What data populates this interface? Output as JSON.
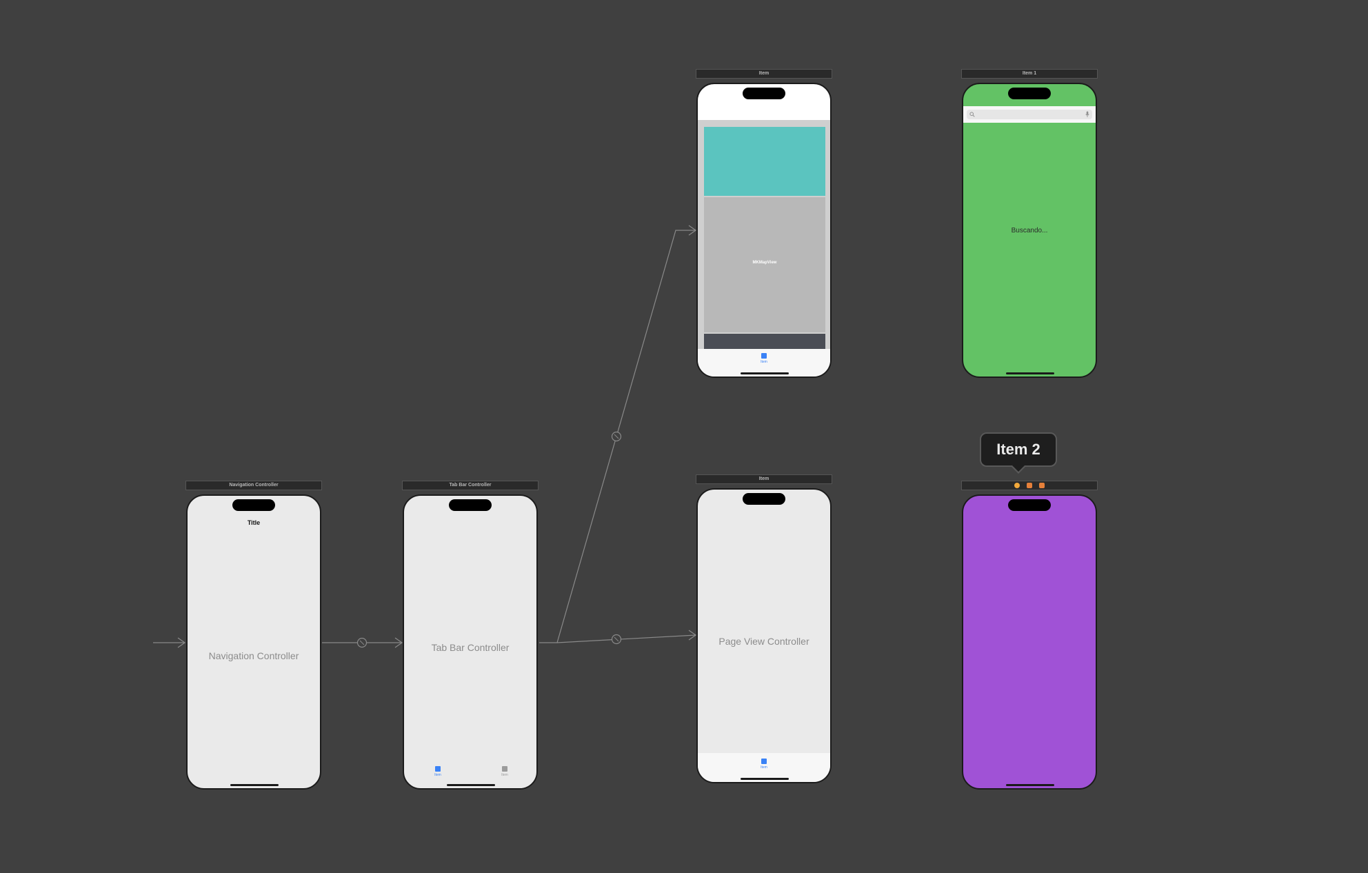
{
  "canvas": {
    "background": "#404040",
    "connector_color": "#8a8a8a"
  },
  "navigation_controller": {
    "scene_title": "Navigation Controller",
    "nav_title": "Title",
    "center_label": "Navigation Controller"
  },
  "tab_bar_controller": {
    "scene_title": "Tab Bar Controller",
    "center_label": "Tab Bar Controller",
    "tabs": [
      {
        "label": "Item",
        "color": "#3a82f6",
        "icon": "tab-item-icon",
        "selected": true
      },
      {
        "label": "Item",
        "color": "#9b9b9b",
        "icon": "tab-item-icon",
        "selected": false
      }
    ]
  },
  "map_scene": {
    "scene_title": "Item",
    "map_label": "MKMapView",
    "top_view_color": "#5bc4bf",
    "map_color": "#b8b8b8",
    "bottom_strip_color": "#4a4d55",
    "tab_label": "Item"
  },
  "page_view_scene": {
    "scene_title": "Item",
    "center_label": "Page View Controller",
    "tab_label": "Item"
  },
  "search_scene": {
    "scene_title": "Item 1",
    "background_color": "#63c265",
    "status_text": "Buscando...",
    "search_icon": "magnifier-icon",
    "mic_icon": "microphone-icon"
  },
  "purple_scene": {
    "background_color": "#a052d6",
    "scene_icons": [
      "view-controller-icon",
      "first-responder-icon",
      "exit-icon"
    ],
    "tooltip": "Item 2"
  }
}
